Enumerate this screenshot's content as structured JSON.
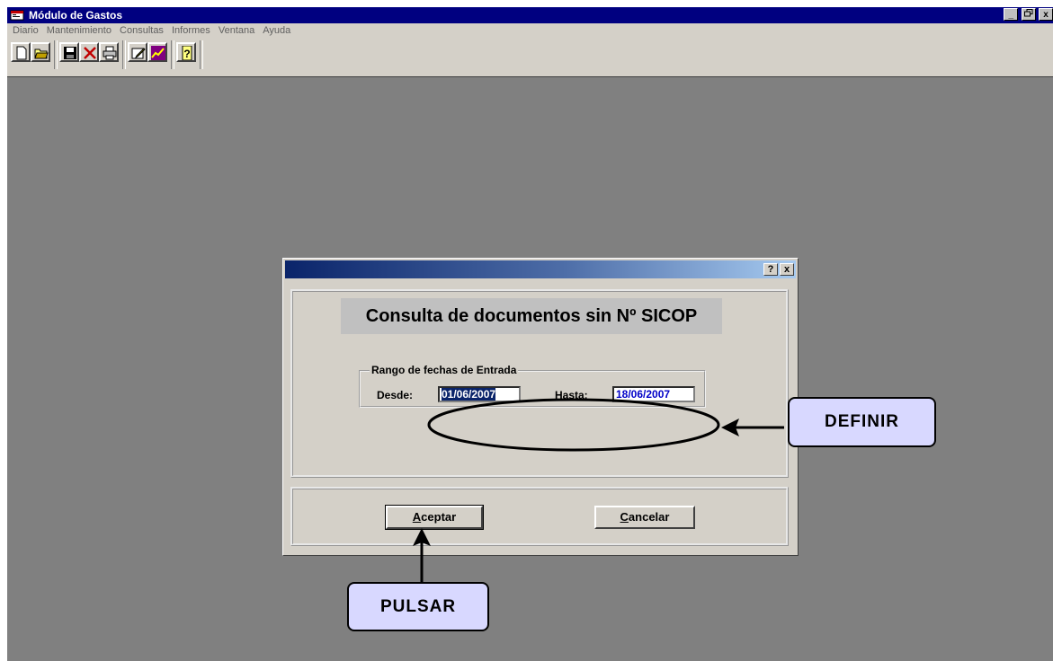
{
  "window": {
    "title": "Módulo de Gastos",
    "controls": [
      "_",
      "🗗",
      "x"
    ]
  },
  "menu": [
    "Diario",
    "Mantenimiento",
    "Consultas",
    "Informes",
    "Ventana",
    "Ayuda"
  ],
  "toolbar": {
    "buttons": [
      "new-icon",
      "open-icon",
      "save-icon",
      "delete-icon",
      "print-icon",
      "edit-icon",
      "chart-icon",
      "help-icon"
    ]
  },
  "dialog": {
    "help_btn": "?",
    "close_btn": "x",
    "heading": "Consulta de documentos sin Nº SICOP",
    "group_title": "Rango de fechas de Entrada",
    "from_label": "Desde:",
    "from_value": "01/06/2007",
    "to_label": "Hasta:",
    "to_value": "18/06/2007",
    "accept_mn": "A",
    "accept_rest": "ceptar",
    "cancel_mn": "C",
    "cancel_rest": "ancelar"
  },
  "annotations": {
    "definir": "DEFINIR",
    "pulsar": "PULSAR"
  },
  "colors": {
    "desktop": "#808080",
    "titlebar": "#000080",
    "face": "#d4d0c8",
    "callout_fill": "#d8d8ff"
  }
}
